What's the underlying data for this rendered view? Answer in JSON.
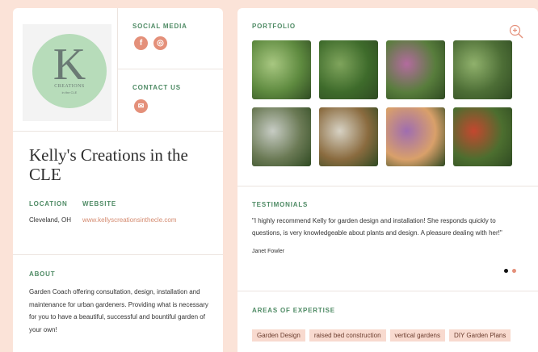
{
  "profile": {
    "name": "Kelly's Creations in the CLE",
    "logo": {
      "letter": "K",
      "line1": "CREATIONS",
      "line2": "in the CLE"
    },
    "labels": {
      "social": "SOCIAL MEDIA",
      "contact": "CONTACT US",
      "location": "LOCATION",
      "website": "WEBSITE",
      "about": "ABOUT"
    },
    "location": "Cleveland, OH",
    "website": "www.kellyscreationsinthecle.com",
    "about": "Garden Coach offering consultation, design, installation and maintenance for urban gardeners. Providing what is necessary for you to have a beautiful, successful and bountiful garden of your own!"
  },
  "icons": {
    "facebook": "f",
    "instagram": "◎",
    "email": "✉"
  },
  "portfolio": {
    "label": "PORTFOLIO",
    "photos": [
      {
        "c1": "#5e8a3f",
        "c2": "#a8c781"
      },
      {
        "c1": "#3e6b2b",
        "c2": "#7fa45c"
      },
      {
        "c1": "#587d3c",
        "c2": "#b36b9e"
      },
      {
        "c1": "#4d6e36",
        "c2": "#90b16c"
      },
      {
        "c1": "#6b7a55",
        "c2": "#c7ccc4"
      },
      {
        "c1": "#8a6b3f",
        "c2": "#d7d2c4"
      },
      {
        "c1": "#d9a06a",
        "c2": "#9f6db0"
      },
      {
        "c1": "#4c6e2f",
        "c2": "#c4472f"
      }
    ]
  },
  "testimonials": {
    "label": "TESTIMONIALS",
    "quote": "\"I highly recommend Kelly for garden design and installation! She responds quickly to questions, is very knowledgeable about plants and design. A pleasure dealing with her!\"",
    "author": "Janet Fowler"
  },
  "expertise": {
    "label": "AREAS OF EXPERTISE",
    "tags": [
      "Garden Design",
      "raised bed construction",
      "vertical gardens",
      "DIY Garden Plans"
    ]
  },
  "colors": {
    "accent": "#e4907a",
    "label_green": "#4f8b65",
    "tag_bg": "#f8dacf"
  }
}
